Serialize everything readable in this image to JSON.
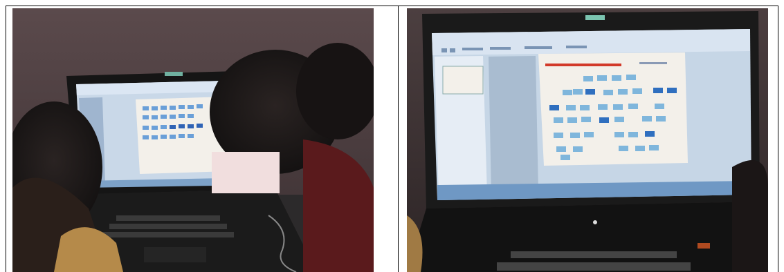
{
  "figure": {
    "panels": [
      {
        "name": "photo-left",
        "description_icon": "photo-students-at-laptop"
      },
      {
        "name": "photo-right",
        "description_icon": "photo-laptop-screen-closeup"
      }
    ]
  },
  "colors": {
    "wall": "#6a5758",
    "screen": "#c9d8e8",
    "slide": "#f3f0ea",
    "box": "#6a9fd8",
    "box_dark": "#2f63b5",
    "laptop_body": "#1b1b1b",
    "redaction": "#f1dede"
  }
}
